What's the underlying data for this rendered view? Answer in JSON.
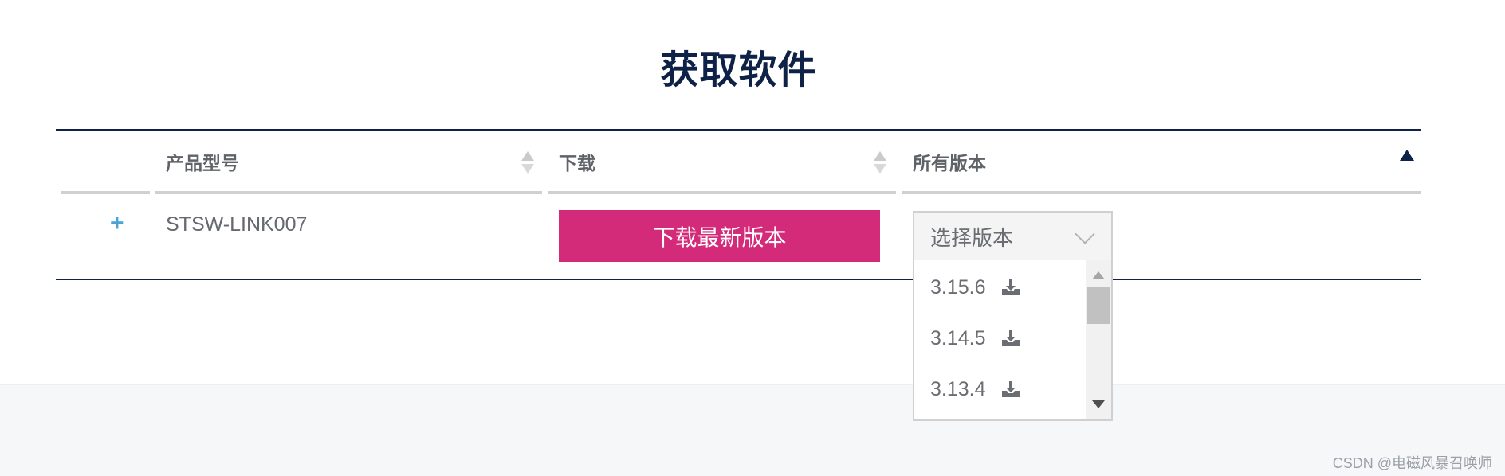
{
  "page": {
    "title": "获取软件"
  },
  "table": {
    "headers": [
      {
        "label": "产品型号"
      },
      {
        "label": "下载"
      },
      {
        "label": "所有版本"
      }
    ],
    "rows": [
      {
        "expand_symbol": "+",
        "product": "STSW-LINK007",
        "download_label": "下载最新版本",
        "version_select": {
          "placeholder": "选择版本",
          "options": [
            "3.15.6",
            "3.14.5",
            "3.13.4"
          ]
        }
      }
    ]
  },
  "icons": {
    "download": "download-icon",
    "chevron": "chevron-down-icon",
    "sort": "sort-icon"
  },
  "colors": {
    "title": "#0d2246",
    "download_button": "#d42a7a",
    "expand": "#4aa3d8"
  },
  "watermark": "CSDN @电磁风暴召唤师"
}
